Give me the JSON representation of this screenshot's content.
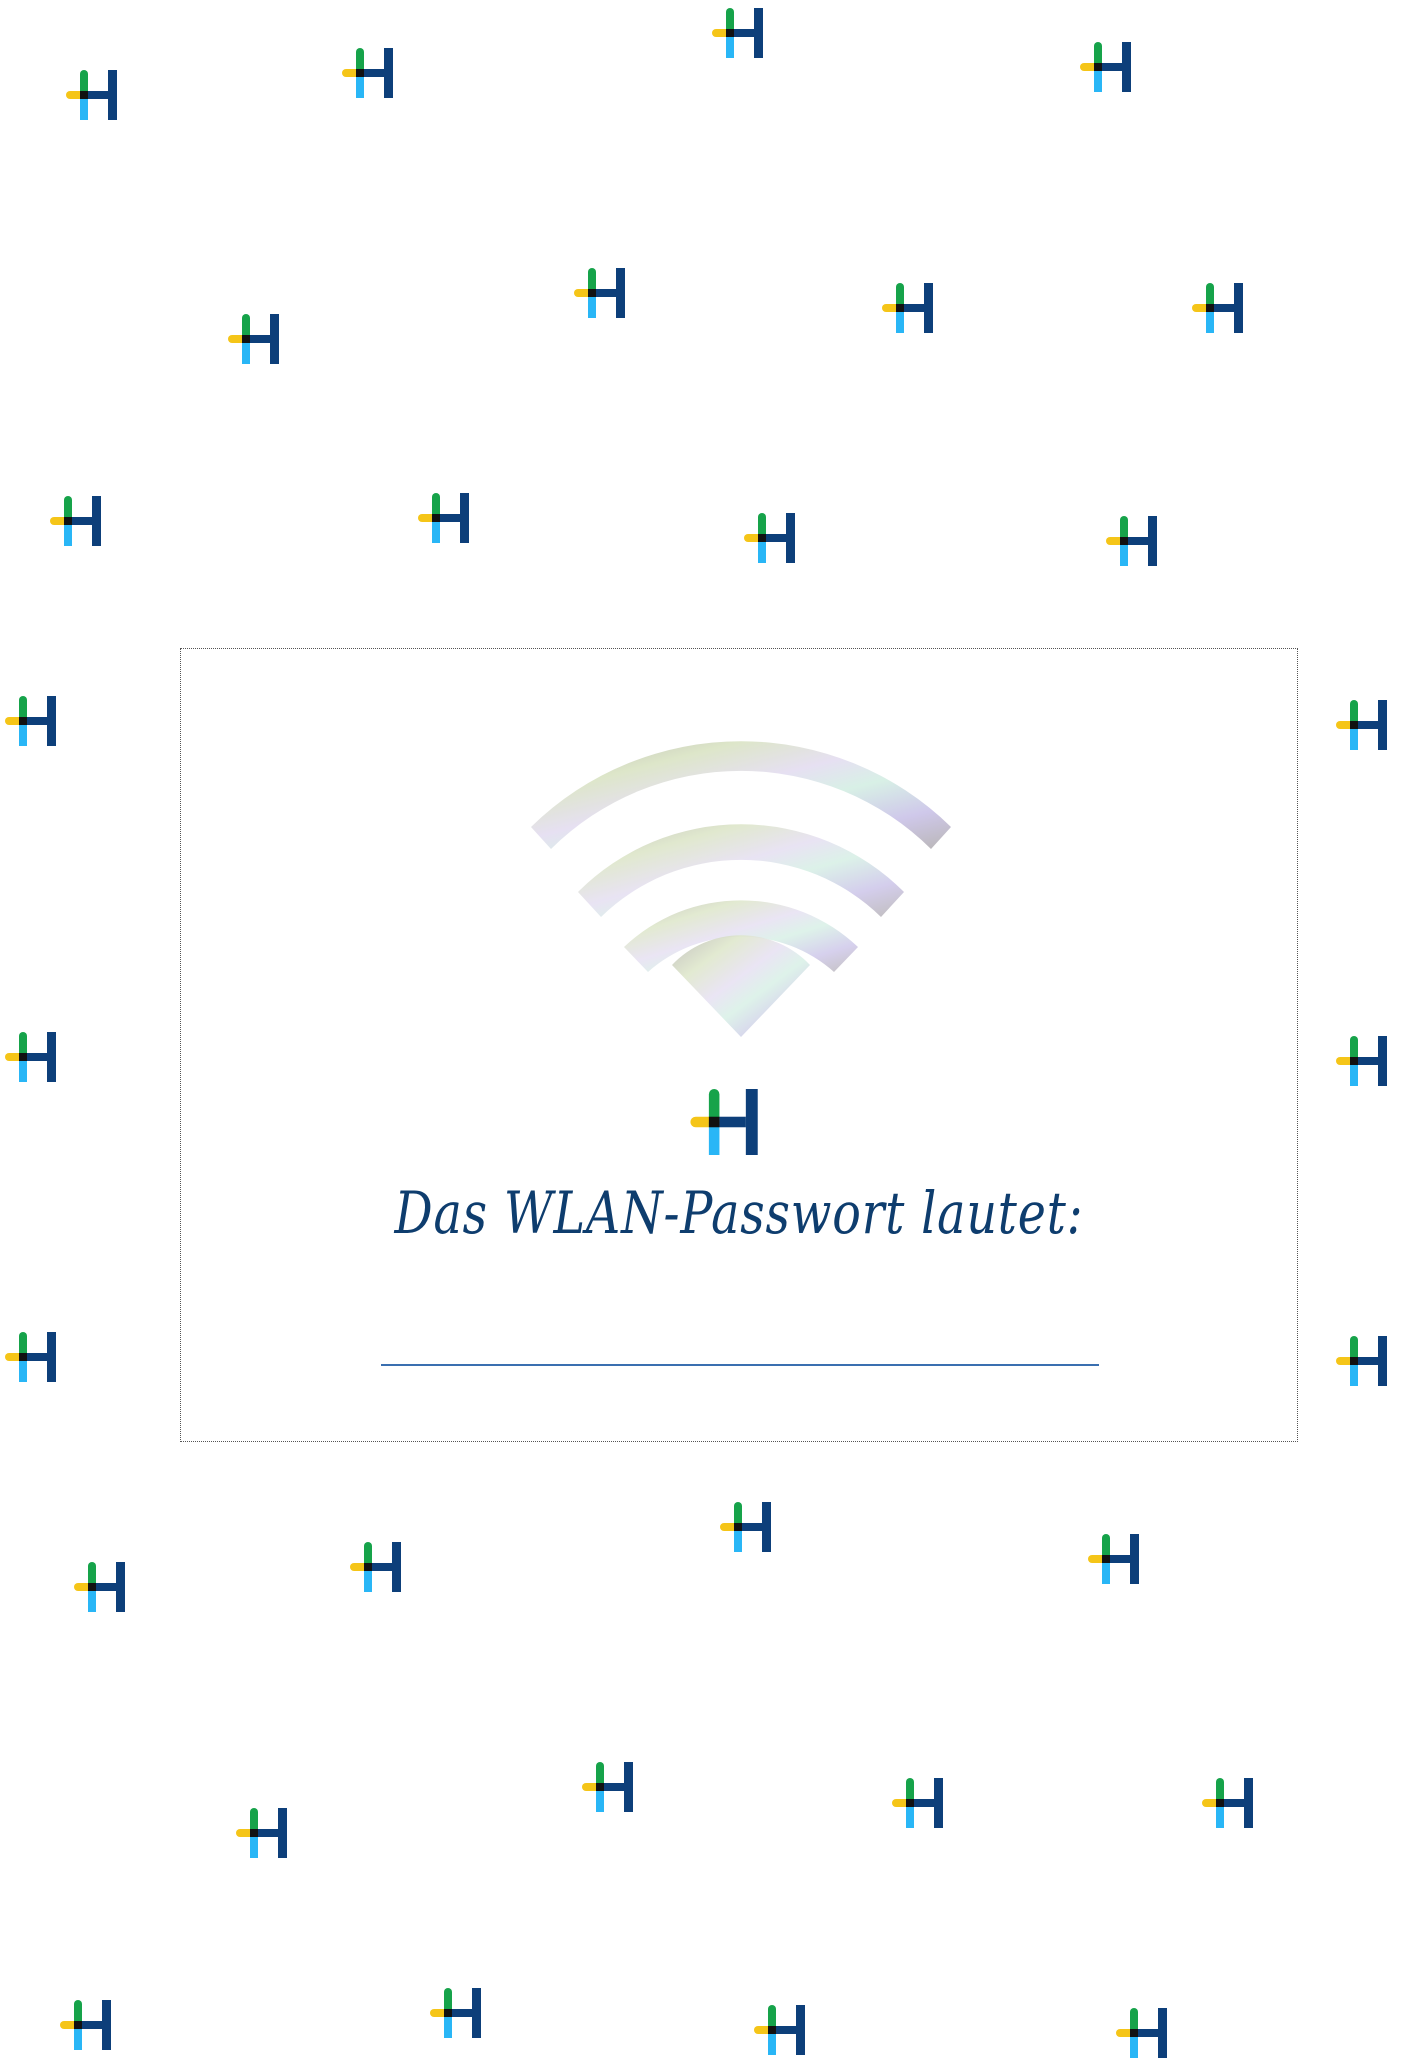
{
  "card": {
    "headline": "Das WLAN-Passwort lautet:"
  },
  "colors": {
    "logo_green": "#16a34a",
    "logo_yellow": "#f5c518",
    "logo_cyan": "#29b6f6",
    "logo_navy": "#0d3f7a",
    "text_navy": "#0e3d6e",
    "line_blue": "#3a6fb0"
  },
  "icons": {
    "pattern": "h-logo-icon",
    "wifi": "wifi-icon"
  }
}
